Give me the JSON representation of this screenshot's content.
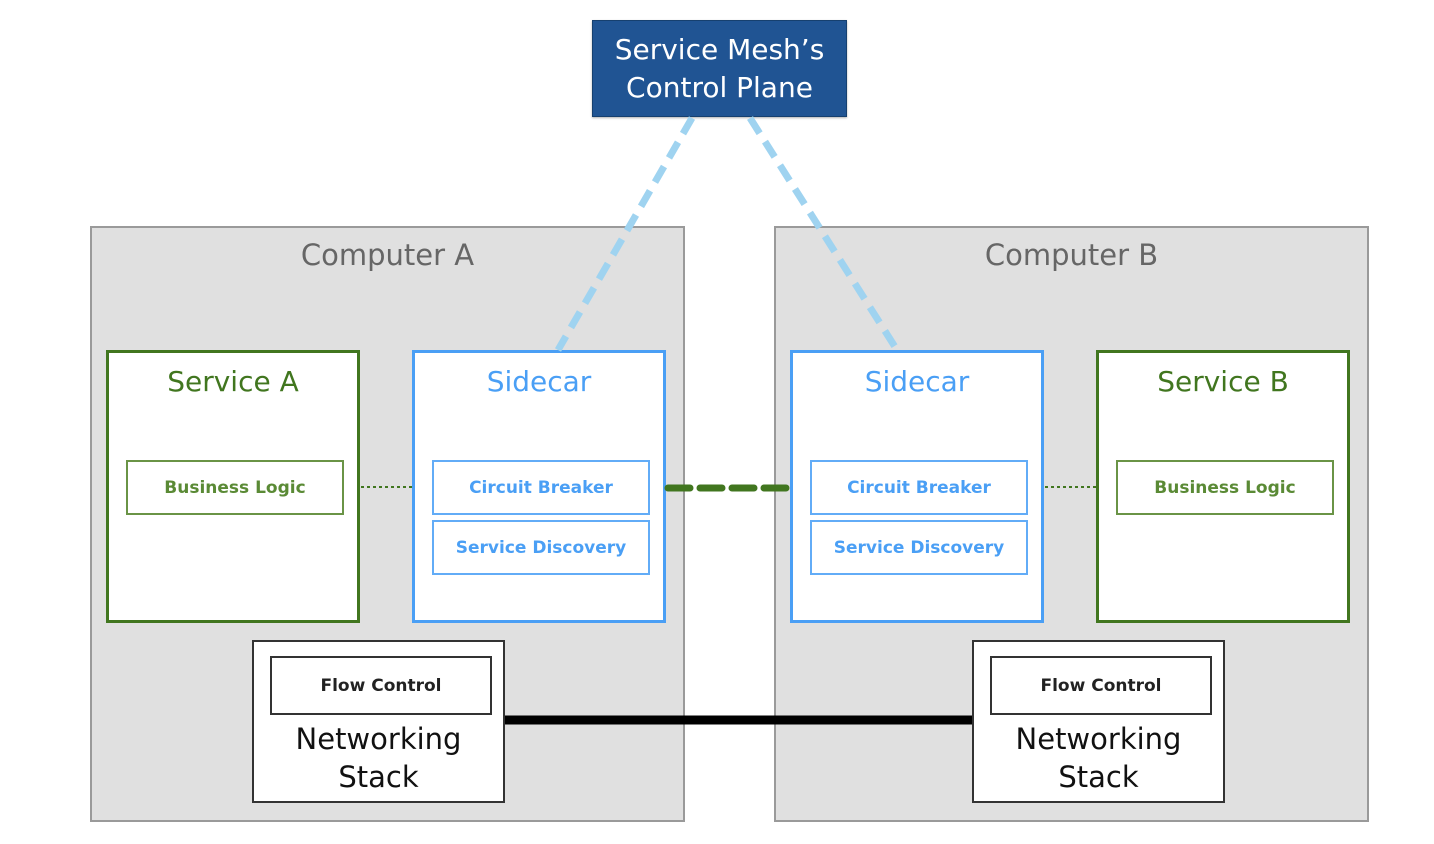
{
  "control_plane": {
    "label_line1": "Service Mesh’s",
    "label_line2": "Control Plane"
  },
  "computers": [
    {
      "title": "Computer A",
      "service": {
        "title": "Service A",
        "component": "Business Logic"
      },
      "sidecar": {
        "title": "Sidecar",
        "components": [
          "Circuit Breaker",
          "Service Discovery"
        ]
      },
      "networking": {
        "component": "Flow Control",
        "title_line1": "Networking",
        "title_line2": "Stack"
      }
    },
    {
      "title": "Computer B",
      "service": {
        "title": "Service B",
        "component": "Business Logic"
      },
      "sidecar": {
        "title": "Sidecar",
        "components": [
          "Circuit Breaker",
          "Service Discovery"
        ]
      },
      "networking": {
        "component": "Flow Control",
        "title_line1": "Networking",
        "title_line2": "Stack"
      }
    }
  ],
  "colors": {
    "control_plane": "#205493",
    "service": "#41761f",
    "sidecar": "#4a9ff5",
    "control_link": "#9fd3f0",
    "sidecar_link": "#41761f",
    "network_link": "#000000"
  }
}
